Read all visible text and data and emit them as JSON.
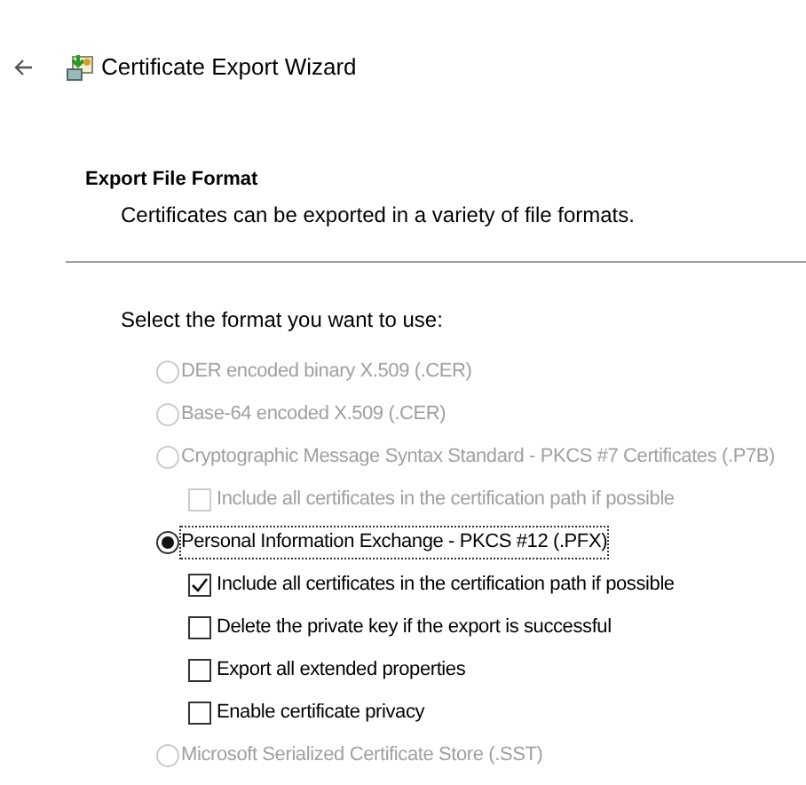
{
  "window": {
    "title": "Certificate Export Wizard"
  },
  "header": {
    "title": "Export File Format",
    "subtitle": "Certificates can be exported in a variety of file formats."
  },
  "prompt": "Select the format you want to use:",
  "formats": [
    {
      "label": "DER encoded binary X.509 (.CER)",
      "selected": false,
      "disabled": true
    },
    {
      "label": "Base-64 encoded X.509 (.CER)",
      "selected": false,
      "disabled": true
    },
    {
      "label": "Cryptographic Message Syntax Standard - PKCS #7 Certificates (.P7B)",
      "selected": false,
      "disabled": true,
      "options": [
        {
          "label": "Include all certificates in the certification path if possible",
          "checked": false,
          "disabled": true
        }
      ]
    },
    {
      "label": "Personal Information Exchange - PKCS #12 (.PFX)",
      "selected": true,
      "disabled": false,
      "options": [
        {
          "label": "Include all certificates in the certification path if possible",
          "checked": true,
          "disabled": false
        },
        {
          "label": "Delete the private key if the export is successful",
          "checked": false,
          "disabled": false
        },
        {
          "label": "Export all extended properties",
          "checked": false,
          "disabled": false
        },
        {
          "label": "Enable certificate privacy",
          "checked": false,
          "disabled": false
        }
      ]
    },
    {
      "label": "Microsoft Serialized Certificate Store (.SST)",
      "selected": false,
      "disabled": true
    }
  ]
}
